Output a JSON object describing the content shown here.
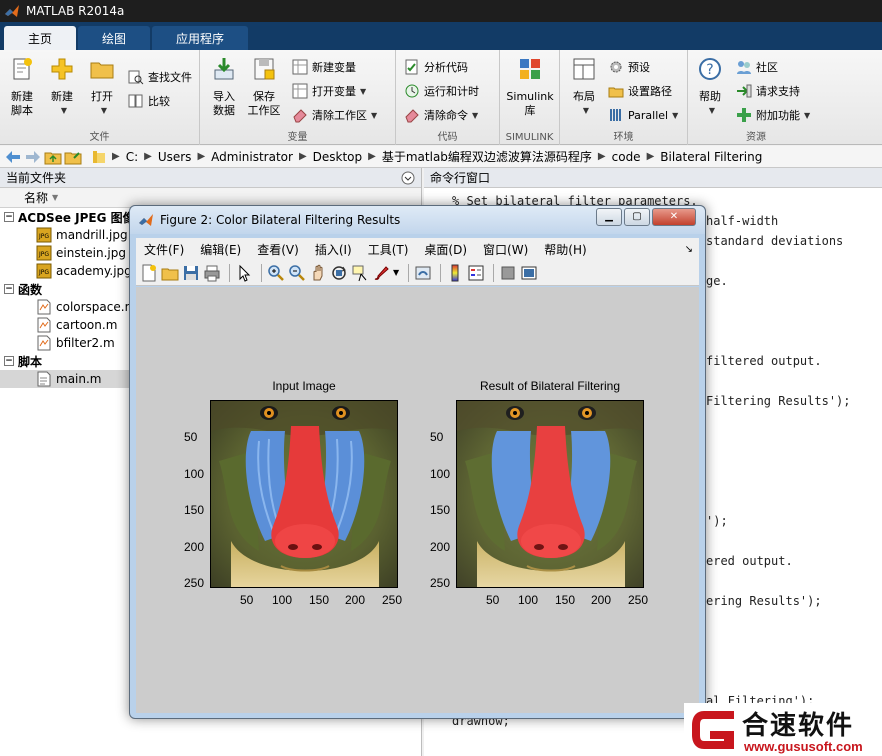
{
  "app": {
    "title": "MATLAB R2014a"
  },
  "ribbon_tabs": [
    "主页",
    "绘图",
    "应用程序"
  ],
  "ribbon": {
    "file": {
      "new_script": "新建\n脚本",
      "new": "新建",
      "open": "打开",
      "find_files": "查找文件",
      "compare": "比较",
      "label": "文件"
    },
    "variable": {
      "import": "导入\n数据",
      "save_ws": "保存\n工作区",
      "new_var": "新建变量",
      "open_var": "打开变量",
      "clear_ws": "清除工作区",
      "label": "变量"
    },
    "code": {
      "analyze": "分析代码",
      "run_time": "运行和计时",
      "clear_cmd": "清除命令",
      "label": "代码"
    },
    "simulink": {
      "lib": "Simulink\n库",
      "label": "SIMULINK"
    },
    "env": {
      "layout": "布局",
      "prefs": "预设",
      "set_path": "设置路径",
      "parallel": "Parallel",
      "label": "环境"
    },
    "resources": {
      "help": "帮助",
      "community": "社区",
      "support": "请求支持",
      "addons": "附加功能",
      "label": "资源"
    }
  },
  "address": [
    "C:",
    "Users",
    "Administrator",
    "Desktop",
    "基于matlab编程双边滤波算法源码程序",
    "code",
    "Bilateral Filtering"
  ],
  "folder_panel": {
    "title": "当前文件夹",
    "column": "名称",
    "sections": [
      {
        "name": "ACDSee JPEG 图像",
        "files": [
          "mandrill.jpg",
          "einstein.jpg",
          "academy.jpg"
        ]
      },
      {
        "name": "函数",
        "files": [
          "colorspace.m",
          "cartoon.m",
          "bfilter2.m"
        ]
      },
      {
        "name": "脚本",
        "files": [
          "main.m"
        ]
      }
    ]
  },
  "command_window": {
    "title": "命令行窗口",
    "lines": [
      "% Set bilateral filter parameters.",
      "half-width",
      "standard deviations",
      "ge.",
      "filtered output.",
      "Filtering Results');",
      "');",
      "ered output.",
      "ering Results');",
      "al Filtering');",
      "drawnow;"
    ]
  },
  "figure": {
    "title": "Figure 2: Color Bilateral Filtering Results",
    "menu": [
      "文件(F)",
      "编辑(E)",
      "查看(V)",
      "插入(I)",
      "工具(T)",
      "桌面(D)",
      "窗口(W)",
      "帮助(H)"
    ],
    "axes": [
      {
        "title": "Input Image",
        "yticks": [
          "50",
          "100",
          "150",
          "200",
          "250"
        ],
        "xticks": [
          "50",
          "100",
          "150",
          "200",
          "250"
        ]
      },
      {
        "title": "Result of Bilateral Filtering",
        "yticks": [
          "50",
          "100",
          "150",
          "200",
          "250"
        ],
        "xticks": [
          "50",
          "100",
          "150",
          "200",
          "250"
        ]
      }
    ]
  },
  "watermark": {
    "brand": "合速软件",
    "url": "www.gususoft.com"
  }
}
